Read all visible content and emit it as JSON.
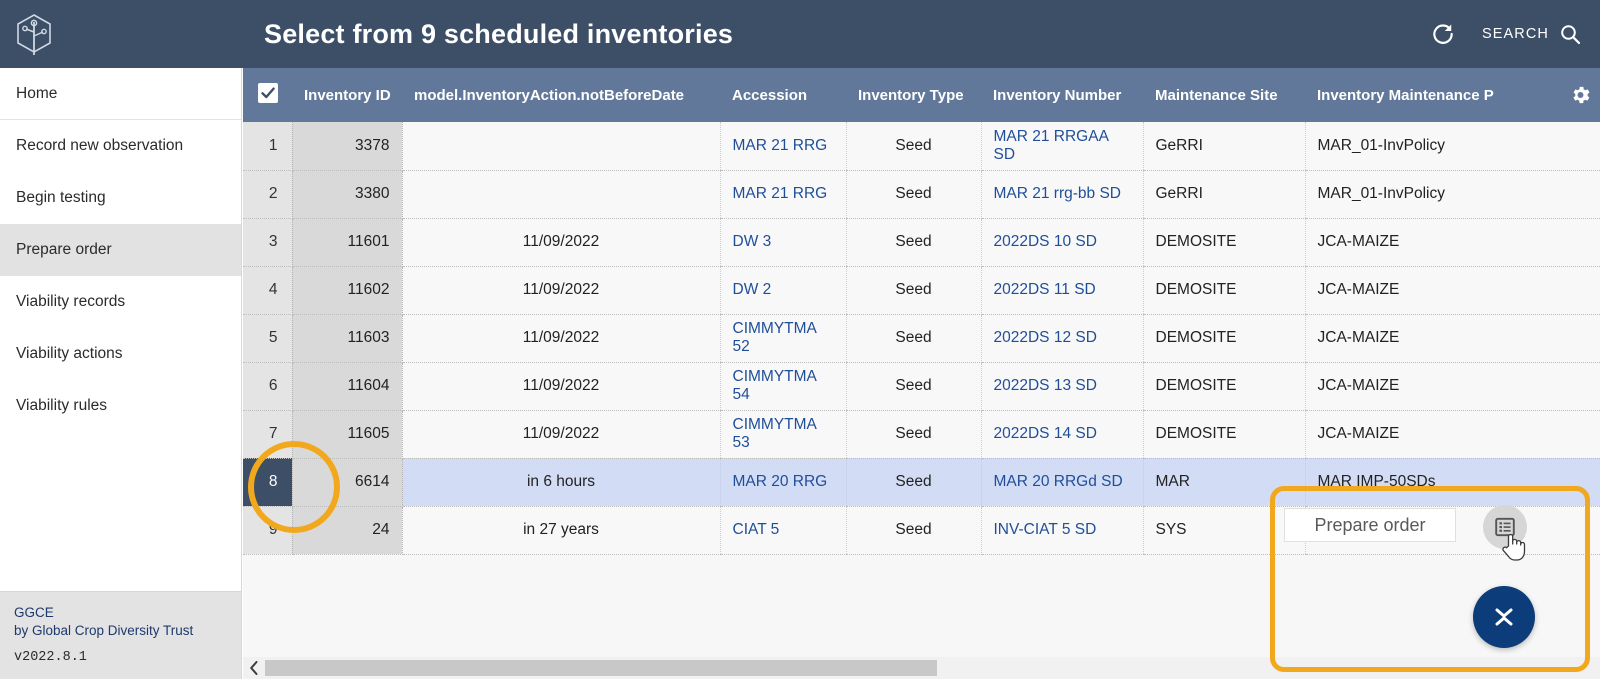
{
  "appbar": {
    "logo_icon": "hexagon-seedling-logo",
    "title": "Select from 9 scheduled inventories",
    "refresh_icon": "refresh-icon",
    "search_label": "SEARCH",
    "search_icon": "search-icon",
    "background_color": "#3d4f66"
  },
  "sidebar": {
    "items": [
      {
        "label": "Home",
        "active": false
      },
      {
        "label": "Record new observation",
        "active": false
      },
      {
        "label": "Begin testing",
        "active": false
      },
      {
        "label": "Prepare order",
        "active": true
      },
      {
        "label": "Viability records",
        "active": false
      },
      {
        "label": "Viability actions",
        "active": false
      },
      {
        "label": "Viability rules",
        "active": false
      }
    ],
    "footer": {
      "brand": "GGCE",
      "byline": "by Global Crop Diversity Trust",
      "version": "v2022.8.1",
      "brand_color": "#1d3a6b"
    }
  },
  "table": {
    "header_color": "#62789a",
    "select_all_checked": true,
    "select_all_icon": "checkbox-checked-icon",
    "settings_icon": "gear-icon",
    "columns": [
      "Inventory ID",
      "model.InventoryAction.notBeforeDate",
      "Accession",
      "Inventory Type",
      "Inventory Number",
      "Maintenance Site",
      "Inventory Maintenance P"
    ],
    "rows": [
      {
        "num": "1",
        "inventory_id": "3378",
        "not_before_date": "",
        "accession": "MAR 21 RRG",
        "inventory_type": "Seed",
        "inventory_number": "MAR 21 RRGAA SD",
        "maintenance_site": "GeRRI",
        "policy": "MAR_01-InvPolicy",
        "selected": false
      },
      {
        "num": "2",
        "inventory_id": "3380",
        "not_before_date": "",
        "accession": "MAR 21 RRG",
        "inventory_type": "Seed",
        "inventory_number": "MAR 21 rrg-bb SD",
        "maintenance_site": "GeRRI",
        "policy": "MAR_01-InvPolicy",
        "selected": false
      },
      {
        "num": "3",
        "inventory_id": "11601",
        "not_before_date": "11/09/2022",
        "accession": "DW 3",
        "inventory_type": "Seed",
        "inventory_number": "2022DS 10 SD",
        "maintenance_site": "DEMOSITE",
        "policy": "JCA-MAIZE",
        "selected": false
      },
      {
        "num": "4",
        "inventory_id": "11602",
        "not_before_date": "11/09/2022",
        "accession": "DW 2",
        "inventory_type": "Seed",
        "inventory_number": "2022DS 11 SD",
        "maintenance_site": "DEMOSITE",
        "policy": "JCA-MAIZE",
        "selected": false
      },
      {
        "num": "5",
        "inventory_id": "11603",
        "not_before_date": "11/09/2022",
        "accession": "CIMMYTMA 52",
        "inventory_type": "Seed",
        "inventory_number": "2022DS 12 SD",
        "maintenance_site": "DEMOSITE",
        "policy": "JCA-MAIZE",
        "selected": false
      },
      {
        "num": "6",
        "inventory_id": "11604",
        "not_before_date": "11/09/2022",
        "accession": "CIMMYTMA 54",
        "inventory_type": "Seed",
        "inventory_number": "2022DS 13 SD",
        "maintenance_site": "DEMOSITE",
        "policy": "JCA-MAIZE",
        "selected": false
      },
      {
        "num": "7",
        "inventory_id": "11605",
        "not_before_date": "11/09/2022",
        "accession": "CIMMYTMA 53",
        "inventory_type": "Seed",
        "inventory_number": "2022DS 14 SD",
        "maintenance_site": "DEMOSITE",
        "policy": "JCA-MAIZE",
        "selected": false
      },
      {
        "num": "8",
        "inventory_id": "6614",
        "not_before_date": "in 6 hours",
        "accession": "MAR 20 RRG",
        "inventory_type": "Seed",
        "inventory_number": "MAR 20 RRGd SD",
        "maintenance_site": "MAR",
        "policy": "MAR IMP-50SDs",
        "selected": true
      },
      {
        "num": "9",
        "inventory_id": "24",
        "not_before_date": "in 27 years",
        "accession": "CIAT 5",
        "inventory_type": "Seed",
        "inventory_number": "INV-CIAT 5 SD",
        "maintenance_site": "SYS",
        "policy": "",
        "selected": false
      }
    ]
  },
  "floating": {
    "tooltip_label": "Prepare order",
    "action_button_icon": "list-view-icon",
    "fab_icon": "collapse-chevrons-icon",
    "cursor_icon": "pointer-hand-cursor"
  },
  "scrollbar": {
    "left_arrow_icon": "chevron-left-icon"
  },
  "annotations": {
    "highlight_color": "#f2a81c",
    "circle_target": "row-8-number-cell",
    "rect_target": "floating-action-area"
  }
}
